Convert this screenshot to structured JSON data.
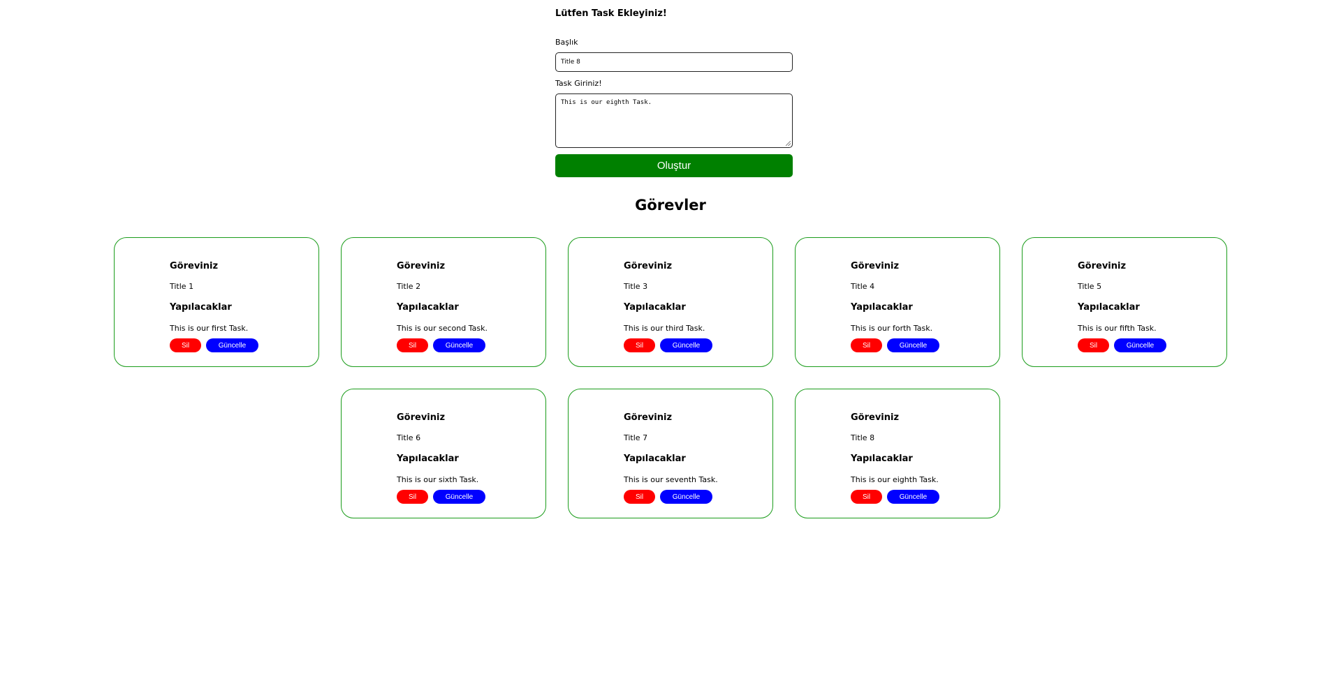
{
  "form": {
    "heading": "Lütfen Task Ekleyiniz!",
    "title_label": "Başlık",
    "title_value": "Title 8",
    "task_label": "Task Giriniz!",
    "task_value": "This is our eighth Task.",
    "submit_label": "Oluştur"
  },
  "tasks_section": {
    "heading": "Görevler"
  },
  "card_labels": {
    "task_heading": "Göreviniz",
    "todo_heading": "Yapılacaklar",
    "delete_label": "Sil",
    "update_label": "Güncelle"
  },
  "tasks": [
    {
      "title": "Title 1",
      "description": "This is our first Task."
    },
    {
      "title": "Title 2",
      "description": "This is our second Task."
    },
    {
      "title": "Title 3",
      "description": "This is our third Task."
    },
    {
      "title": "Title 4",
      "description": "This is our forth Task."
    },
    {
      "title": "Title 5",
      "description": "This is our fifth Task."
    },
    {
      "title": "Title 6",
      "description": "This is our sixth Task."
    },
    {
      "title": "Title 7",
      "description": "This is our seventh Task."
    },
    {
      "title": "Title 8",
      "description": "This is our eighth Task."
    }
  ],
  "colors": {
    "create_button": "#008000",
    "delete_button": "#ff0000",
    "update_button": "#0000ff",
    "card_border": "#1a9c1a"
  }
}
